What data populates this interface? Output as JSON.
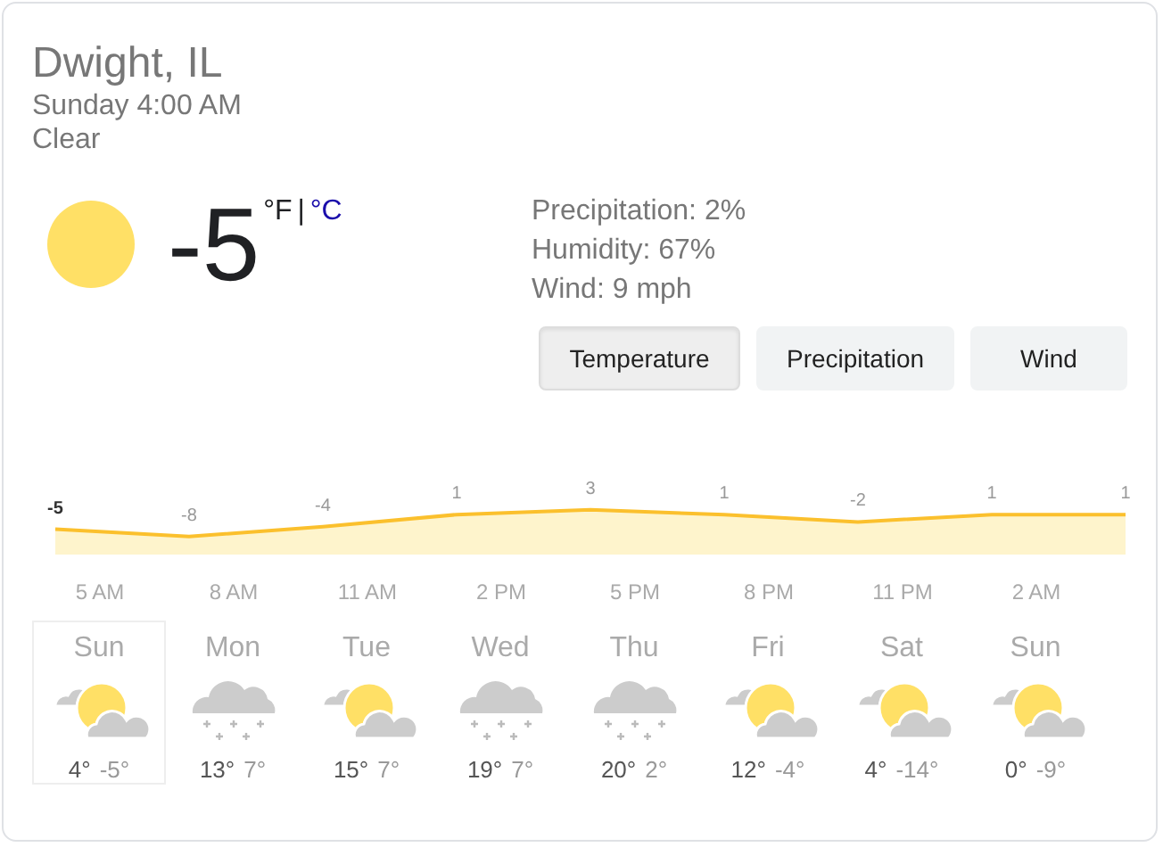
{
  "location": "Dwight, IL",
  "time": "Sunday 4:00 AM",
  "condition": "Clear",
  "current": {
    "kind": "sunny",
    "temperature": "-5",
    "units": [
      {
        "label": "°F",
        "selected": true
      },
      {
        "label": "°C",
        "selected": false
      }
    ],
    "separator": "|"
  },
  "details": [
    "Precipitation: 2%",
    "Humidity: 67%",
    "Wind: 9 mph"
  ],
  "tabs": [
    {
      "label": "Temperature",
      "selected": true
    },
    {
      "label": "Precipitation",
      "selected": false
    },
    {
      "label": "Wind",
      "selected": false
    }
  ],
  "hourly": {
    "chart_data": {
      "type": "area",
      "categories": [
        null,
        null,
        null,
        null,
        null,
        null,
        null,
        null,
        null
      ],
      "series": [
        {
          "color": "#fbc02d",
          "values": [
            -5,
            -8,
            -4,
            1,
            3,
            1,
            -2,
            1,
            1
          ]
        }
      ],
      "data_labels": true
    },
    "time_labels": [
      "5 AM",
      "8 AM",
      "11 AM",
      "2 PM",
      "5 PM",
      "8 PM",
      "11 PM",
      "2 AM"
    ]
  },
  "forecast": [
    {
      "day": "Sun",
      "kind": "partly-cloudy",
      "high": "4°",
      "low": "-5°",
      "selected": true
    },
    {
      "day": "Mon",
      "kind": "snow",
      "high": "13°",
      "low": "7°",
      "selected": false
    },
    {
      "day": "Tue",
      "kind": "partly-cloudy",
      "high": "15°",
      "low": "7°",
      "selected": false
    },
    {
      "day": "Wed",
      "kind": "snow",
      "high": "19°",
      "low": "7°",
      "selected": false
    },
    {
      "day": "Thu",
      "kind": "snow",
      "high": "20°",
      "low": "2°",
      "selected": false
    },
    {
      "day": "Fri",
      "kind": "partly-cloudy",
      "high": "12°",
      "low": "-4°",
      "selected": false
    },
    {
      "day": "Sat",
      "kind": "partly-cloudy",
      "high": "4°",
      "low": "-14°",
      "selected": false
    },
    {
      "day": "Sun",
      "kind": "partly-cloudy",
      "high": "0°",
      "low": "-9°",
      "selected": false
    }
  ]
}
